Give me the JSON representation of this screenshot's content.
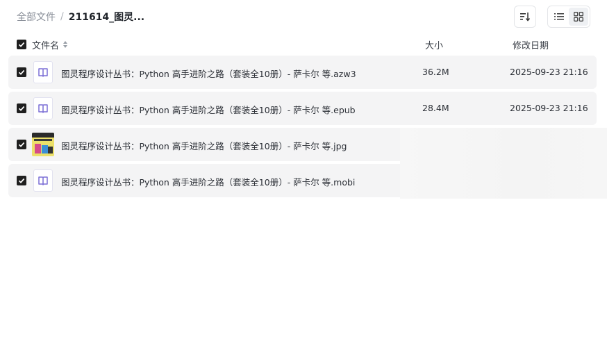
{
  "breadcrumb": {
    "root": "全部文件",
    "separator": "/",
    "current": "211614_图灵..."
  },
  "toolbar": {
    "sort_icon": "sort-descending-icon",
    "view_list_icon": "list-view-icon",
    "view_grid_icon": "grid-view-icon",
    "active_view": "grid"
  },
  "header": {
    "name": "文件名",
    "size": "大小",
    "date": "修改日期"
  },
  "files": [
    {
      "name": "图灵程序设计丛书：Python 高手进阶之路（套装全10册）- 萨卡尔 等.azw3",
      "size": "36.2M",
      "date": "2025-09-23 21:16",
      "icon": "ebook-icon",
      "checked": true
    },
    {
      "name": "图灵程序设计丛书：Python 高手进阶之路（套装全10册）- 萨卡尔 等.epub",
      "size": "28.4M",
      "date": "2025-09-23 21:16",
      "icon": "ebook-icon",
      "checked": true
    },
    {
      "name": "图灵程序设计丛书：Python 高手进阶之路（套装全10册）- 萨卡尔 等.jpg",
      "size": "",
      "date": "",
      "icon": "image-thumbnail",
      "checked": true
    },
    {
      "name": "图灵程序设计丛书：Python 高手进阶之路（套装全10册）- 萨卡尔 等.mobi",
      "size": "",
      "date": "",
      "icon": "ebook-icon",
      "checked": true
    }
  ],
  "colors": {
    "row_bg": "#f4f4f5",
    "checkbox": "#1f1f1f",
    "ebook_icon": "#7b6fd6"
  }
}
